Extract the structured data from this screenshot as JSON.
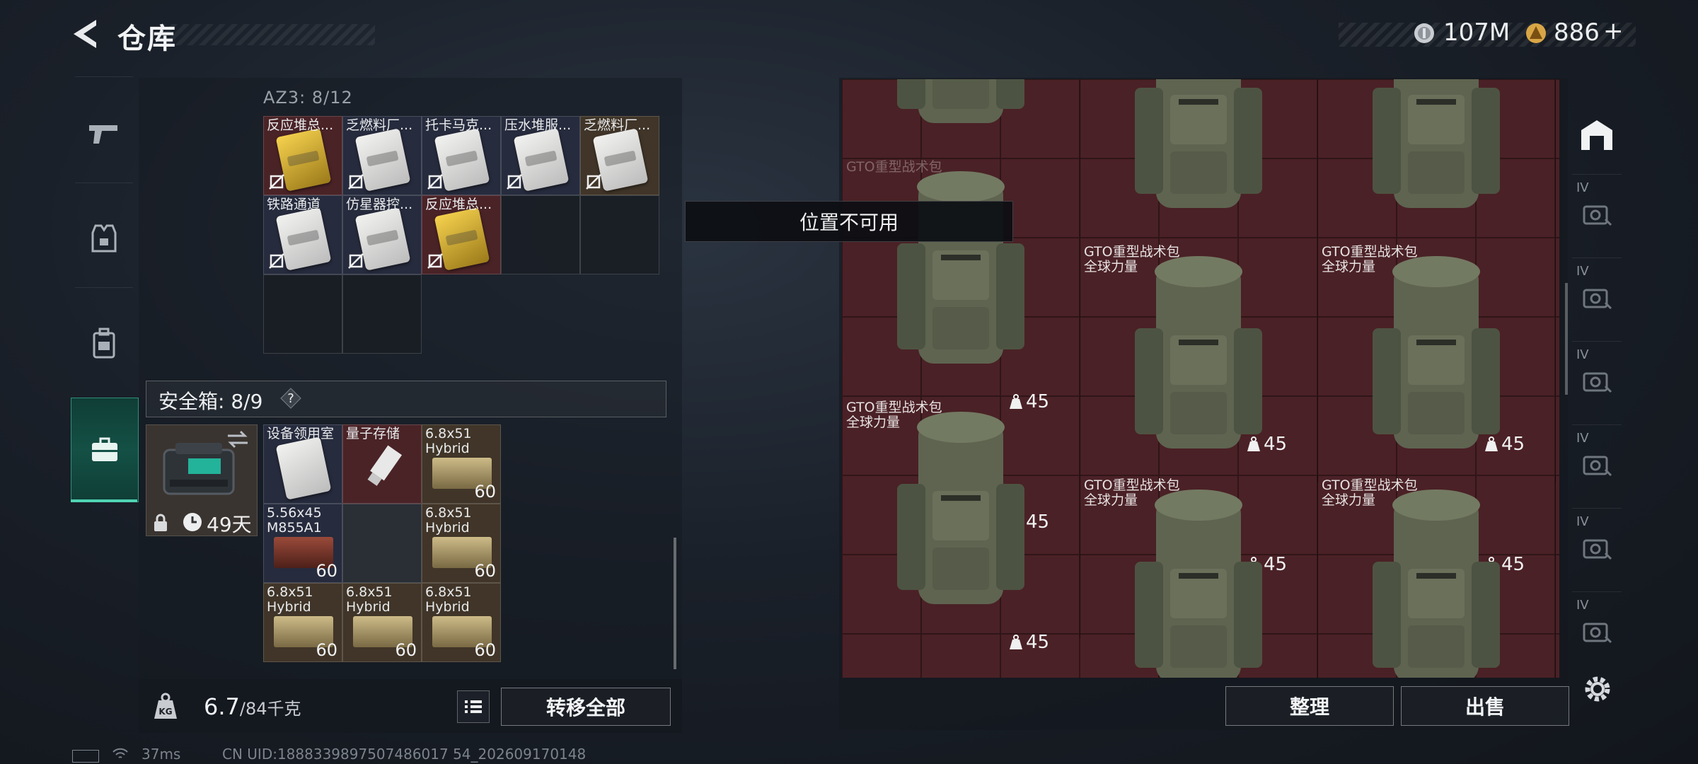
{
  "header": {
    "title": "仓库",
    "currency": [
      {
        "icon": "silver-coin-icon",
        "value": "107M"
      },
      {
        "icon": "gold-coin-icon",
        "value": "886"
      }
    ],
    "add_label": "+"
  },
  "nav": {
    "items": [
      {
        "name": "weapon",
        "icon": "pistol-icon"
      },
      {
        "name": "armor",
        "icon": "vest-icon"
      },
      {
        "name": "backpack",
        "icon": "backpack-icon"
      },
      {
        "name": "storage",
        "icon": "briefcase-icon",
        "active": true
      }
    ]
  },
  "container": {
    "label": "AZ3: 8/12",
    "items": [
      {
        "name": "反应堆总...",
        "card": "gold",
        "bg": "red"
      },
      {
        "name": "乏燃料厂...",
        "card": "white",
        "bg": "navy"
      },
      {
        "name": "托卡马克...",
        "card": "white",
        "bg": "navy"
      },
      {
        "name": "压水堆服...",
        "card": "white",
        "bg": "navy"
      },
      {
        "name": "乏燃料厂...",
        "card": "white",
        "bg": "brown"
      },
      {
        "name": "铁路通道",
        "card": "white",
        "bg": "navy"
      },
      {
        "name": "仿星器控...",
        "card": "white",
        "bg": "navy"
      },
      {
        "name": "反应堆总...",
        "card": "gold",
        "bg": "red"
      }
    ]
  },
  "safebox": {
    "label": "安全箱: 8/9",
    "help": "?",
    "days": "49天",
    "items": [
      {
        "name": "设备领用室",
        "type": "card",
        "bg": "navy",
        "qty": ""
      },
      {
        "name": "量子存储",
        "type": "usb",
        "bg": "red",
        "qty": ""
      },
      {
        "name": "6.8x51\nHybrid",
        "type": "ammo",
        "bg": "brown",
        "qty": "60"
      },
      {
        "name": "5.56x45\nM855A1",
        "type": "ammo-red",
        "bg": "navy",
        "qty": "60"
      },
      {
        "name": "",
        "type": "empty",
        "bg": "dark",
        "qty": ""
      },
      {
        "name": "6.8x51\nHybrid",
        "type": "ammo",
        "bg": "brown",
        "qty": "60"
      },
      {
        "name": "6.8x51\nHybrid",
        "type": "ammo",
        "bg": "brown",
        "qty": "60"
      },
      {
        "name": "6.8x51\nHybrid",
        "type": "ammo",
        "bg": "brown",
        "qty": "60"
      },
      {
        "name": "6.8x51\nHybrid",
        "type": "ammo",
        "bg": "brown",
        "qty": "60"
      }
    ]
  },
  "weight": {
    "current": "6.7",
    "max": "/84千克"
  },
  "buttons": {
    "transfer_all": "转移全部",
    "sort": "整理",
    "sell": "出售"
  },
  "tooltip": "位置不可用",
  "stash": {
    "item_name": "GTO重型战术包\n全球力量",
    "partial_name": "GTO重型战术包",
    "count": "45"
  },
  "right_rail": {
    "slots": [
      {
        "tag": "IV",
        "icon": "add-medkit-icon"
      },
      {
        "tag": "IV",
        "icon": "armor-repair-icon"
      },
      {
        "tag": "IV",
        "icon": "helmet-repair-icon"
      },
      {
        "tag": "IV",
        "icon": "vest-repair-icon"
      },
      {
        "tag": "IV",
        "icon": "weapon-repair-icon"
      },
      {
        "tag": "IV",
        "icon": "storage-expand-icon"
      }
    ]
  },
  "status": {
    "ping": "37ms",
    "uid": "CN UID:1888339897507486017 54_202609170148"
  },
  "colors": {
    "accent": "#4fd3b3",
    "stash_bg": "#4a2126",
    "panel": "#161b22"
  }
}
